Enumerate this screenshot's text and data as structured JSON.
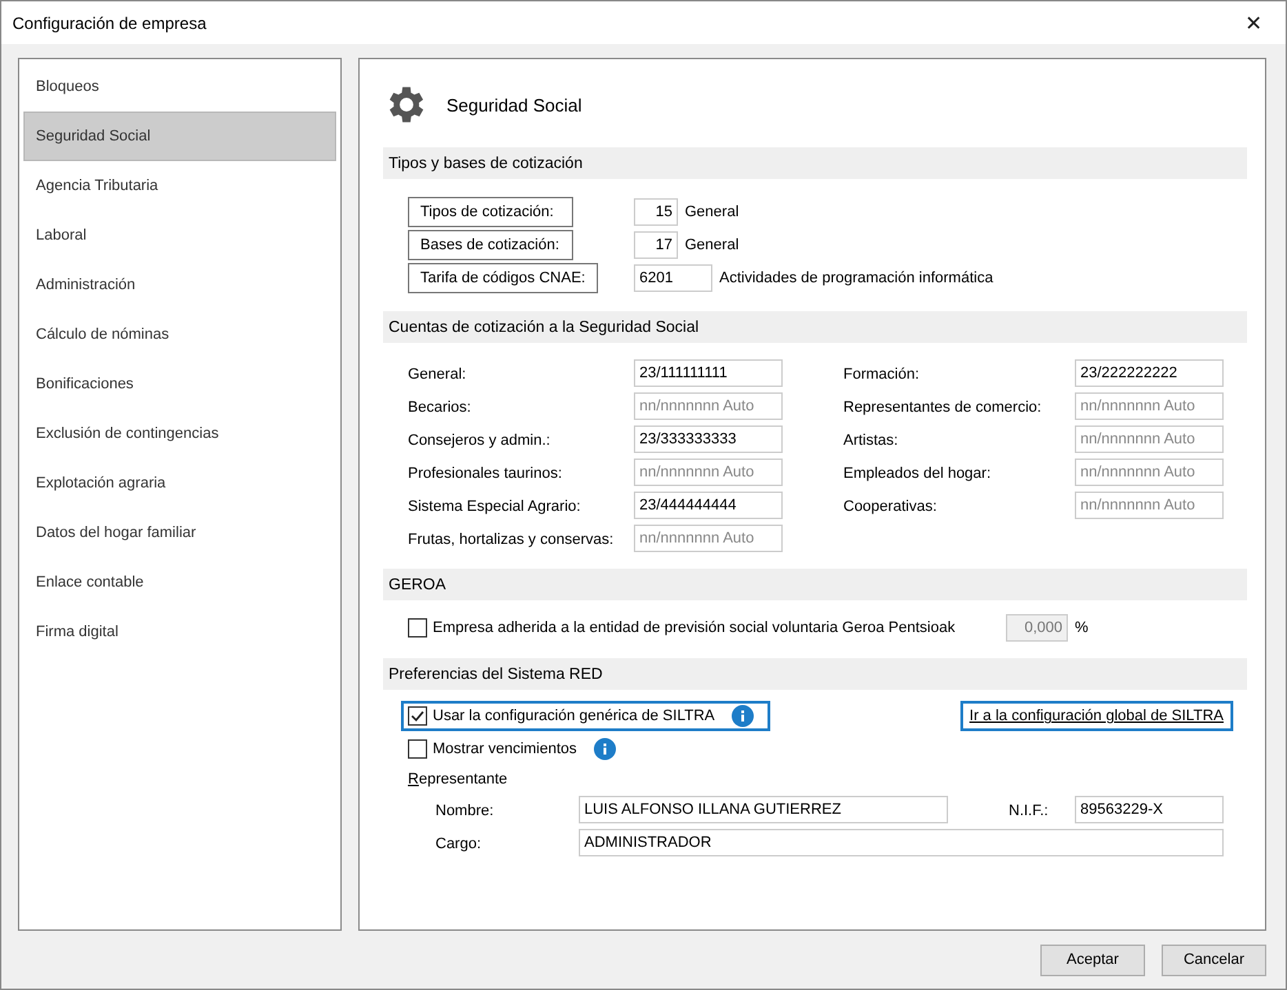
{
  "window": {
    "title": "Configuración de empresa",
    "close": "✕"
  },
  "sidebar": {
    "items": [
      {
        "label": "Bloqueos",
        "selected": false
      },
      {
        "label": "Seguridad Social",
        "selected": true
      },
      {
        "label": "Agencia Tributaria",
        "selected": false
      },
      {
        "label": "Laboral",
        "selected": false
      },
      {
        "label": "Administración",
        "selected": false
      },
      {
        "label": "Cálculo de nóminas",
        "selected": false
      },
      {
        "label": "Bonificaciones",
        "selected": false
      },
      {
        "label": "Exclusión de contingencias",
        "selected": false
      },
      {
        "label": "Explotación agraria",
        "selected": false
      },
      {
        "label": "Datos del hogar familiar",
        "selected": false
      },
      {
        "label": "Enlace contable",
        "selected": false
      },
      {
        "label": "Firma digital",
        "selected": false
      }
    ]
  },
  "page_title": "Seguridad Social",
  "tipos": {
    "heading": "Tipos y bases de cotización",
    "rows": [
      {
        "button": "Tipos de cotización:",
        "code": "15",
        "description": "General",
        "kind": "short"
      },
      {
        "button": "Bases de cotización:",
        "code": "17",
        "description": "General",
        "kind": "short"
      },
      {
        "button": "Tarifa de códigos CNAE:",
        "code": "6201",
        "description": "Actividades de programación informática",
        "kind": "wide"
      }
    ]
  },
  "cuentas": {
    "heading": "Cuentas de cotización a la Seguridad Social",
    "left": [
      {
        "label": "General:",
        "value": "23/111111111"
      },
      {
        "label": "Becarios:",
        "placeholder": "nn/nnnnnnn Auto"
      },
      {
        "label": "Consejeros y admin.:",
        "value": "23/333333333"
      },
      {
        "label": "Profesionales taurinos:",
        "placeholder": "nn/nnnnnnn Auto"
      },
      {
        "label": "Sistema Especial Agrario:",
        "value": "23/444444444"
      },
      {
        "label": "Frutas, hortalizas y conservas:",
        "placeholder": "nn/nnnnnnn Auto"
      }
    ],
    "right": [
      {
        "label": "Formación:",
        "value": "23/222222222"
      },
      {
        "label": "Representantes de comercio:",
        "placeholder": "nn/nnnnnnn Auto"
      },
      {
        "label": "Artistas:",
        "placeholder": "nn/nnnnnnn Auto"
      },
      {
        "label": "Empleados del hogar:",
        "placeholder": "nn/nnnnnnn Auto"
      },
      {
        "label": "Cooperativas:",
        "placeholder": "nn/nnnnnnn Auto"
      }
    ]
  },
  "geroa": {
    "heading": "GEROA",
    "checkbox": {
      "label": "Empresa adherida a la entidad de previsión social voluntaria Geroa Pentsioak",
      "checked": false
    },
    "percent_value": "0,000",
    "percent_disabled": true,
    "unit": "%"
  },
  "red": {
    "heading": "Preferencias del Sistema RED",
    "options": [
      {
        "label": "Usar la configuración genérica de SILTRA",
        "checked": true,
        "focused": true
      },
      {
        "label": "Mostrar vencimientos",
        "checked": false,
        "focused": false
      }
    ],
    "link": "Ir a la configuración global de SILTRA",
    "representante": {
      "heading": "Representante",
      "nombre_label": "Nombre:",
      "nombre": "LUIS ALFONSO ILLANA GUTIERREZ",
      "nif_label": "N.I.F.:",
      "nif": "89563229-X",
      "cargo_label": "Cargo:",
      "cargo": "ADMINISTRADOR"
    }
  },
  "buttons": [
    "Aceptar",
    "Cancelar"
  ]
}
